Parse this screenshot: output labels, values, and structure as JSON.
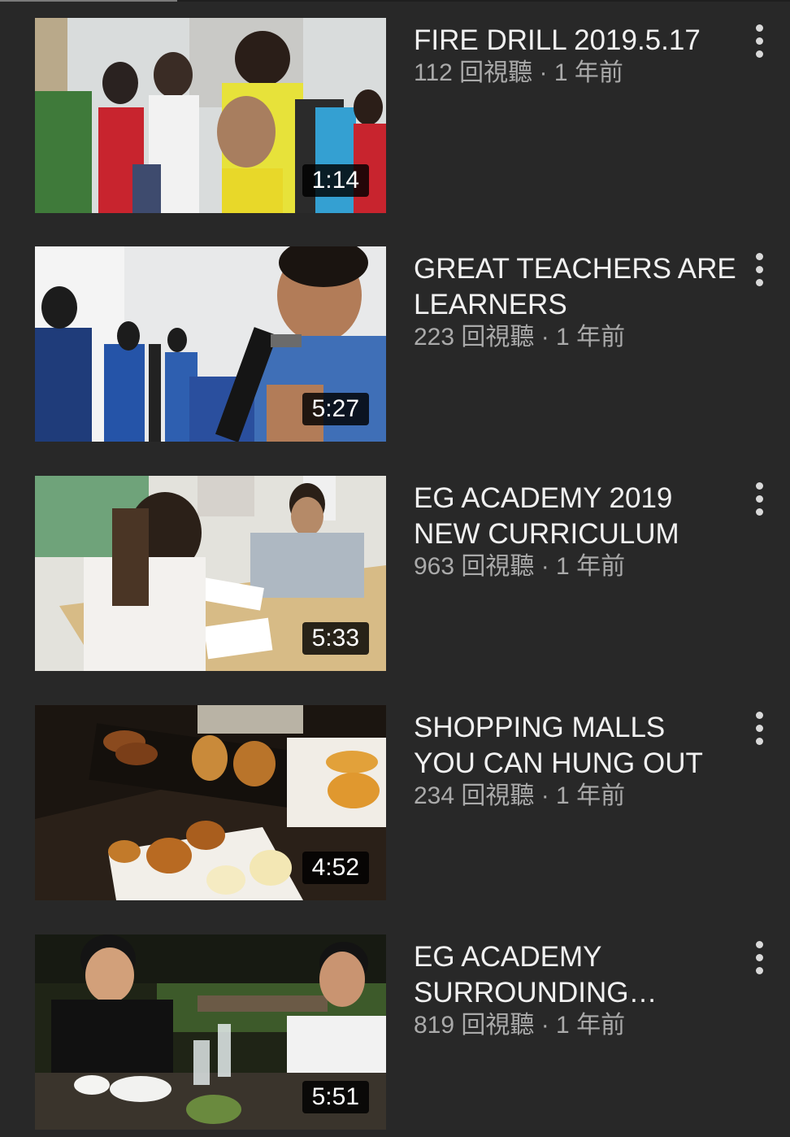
{
  "videos": [
    {
      "title": "FIRE DRILL 2019.5.17",
      "views": "112 回視聽",
      "age": "1 年前",
      "duration": "1:14",
      "stats": "112 回視聽 · 1 年前"
    },
    {
      "title": "GREAT TEACHERS ARE\nLEARNERS",
      "views": "223 回視聽",
      "age": "1 年前",
      "duration": "5:27",
      "stats": "223 回視聽 · 1 年前"
    },
    {
      "title": "EG ACADEMY 2019\nNEW CURRICULUM",
      "views": "963 回視聽",
      "age": "1 年前",
      "duration": "5:33",
      "stats": "963 回視聽 · 1 年前"
    },
    {
      "title": "SHOPPING MALLS\nYOU CAN HUNG OUT",
      "views": "234 回視聽",
      "age": "1 年前",
      "duration": "4:52",
      "stats": "234 回視聽 · 1 年前"
    },
    {
      "title": "EG ACADEMY\nSURROUNDING…",
      "views": "819 回視聽",
      "age": "1 年前",
      "duration": "5:51",
      "stats": "819 回視聽 · 1 年前"
    }
  ],
  "icons": {
    "more": "more-vert-icon"
  },
  "colors": {
    "background": "#282828",
    "title": "#f1f1f1",
    "meta": "#aaaaaa",
    "duration_bg": "#000000"
  }
}
